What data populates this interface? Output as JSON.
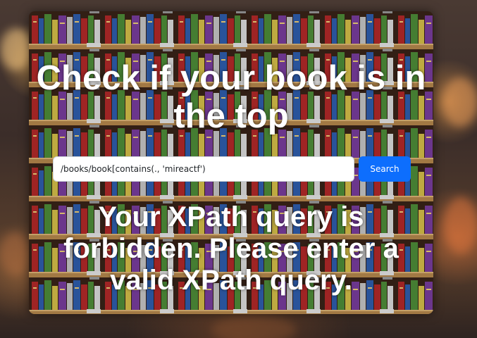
{
  "page": {
    "title": "Check if your book is in the top"
  },
  "search": {
    "value": "/books/book[contains(., 'mireactf')",
    "button_label": "Search"
  },
  "result": {
    "message": "Your XPath query is forbidden. Please enter a valid XPath query."
  },
  "colors": {
    "button": "#0d6efd",
    "text": "#ffffff"
  },
  "background": {
    "image": "pixel-art-bookshelf",
    "backdrop": "blurred-library"
  }
}
